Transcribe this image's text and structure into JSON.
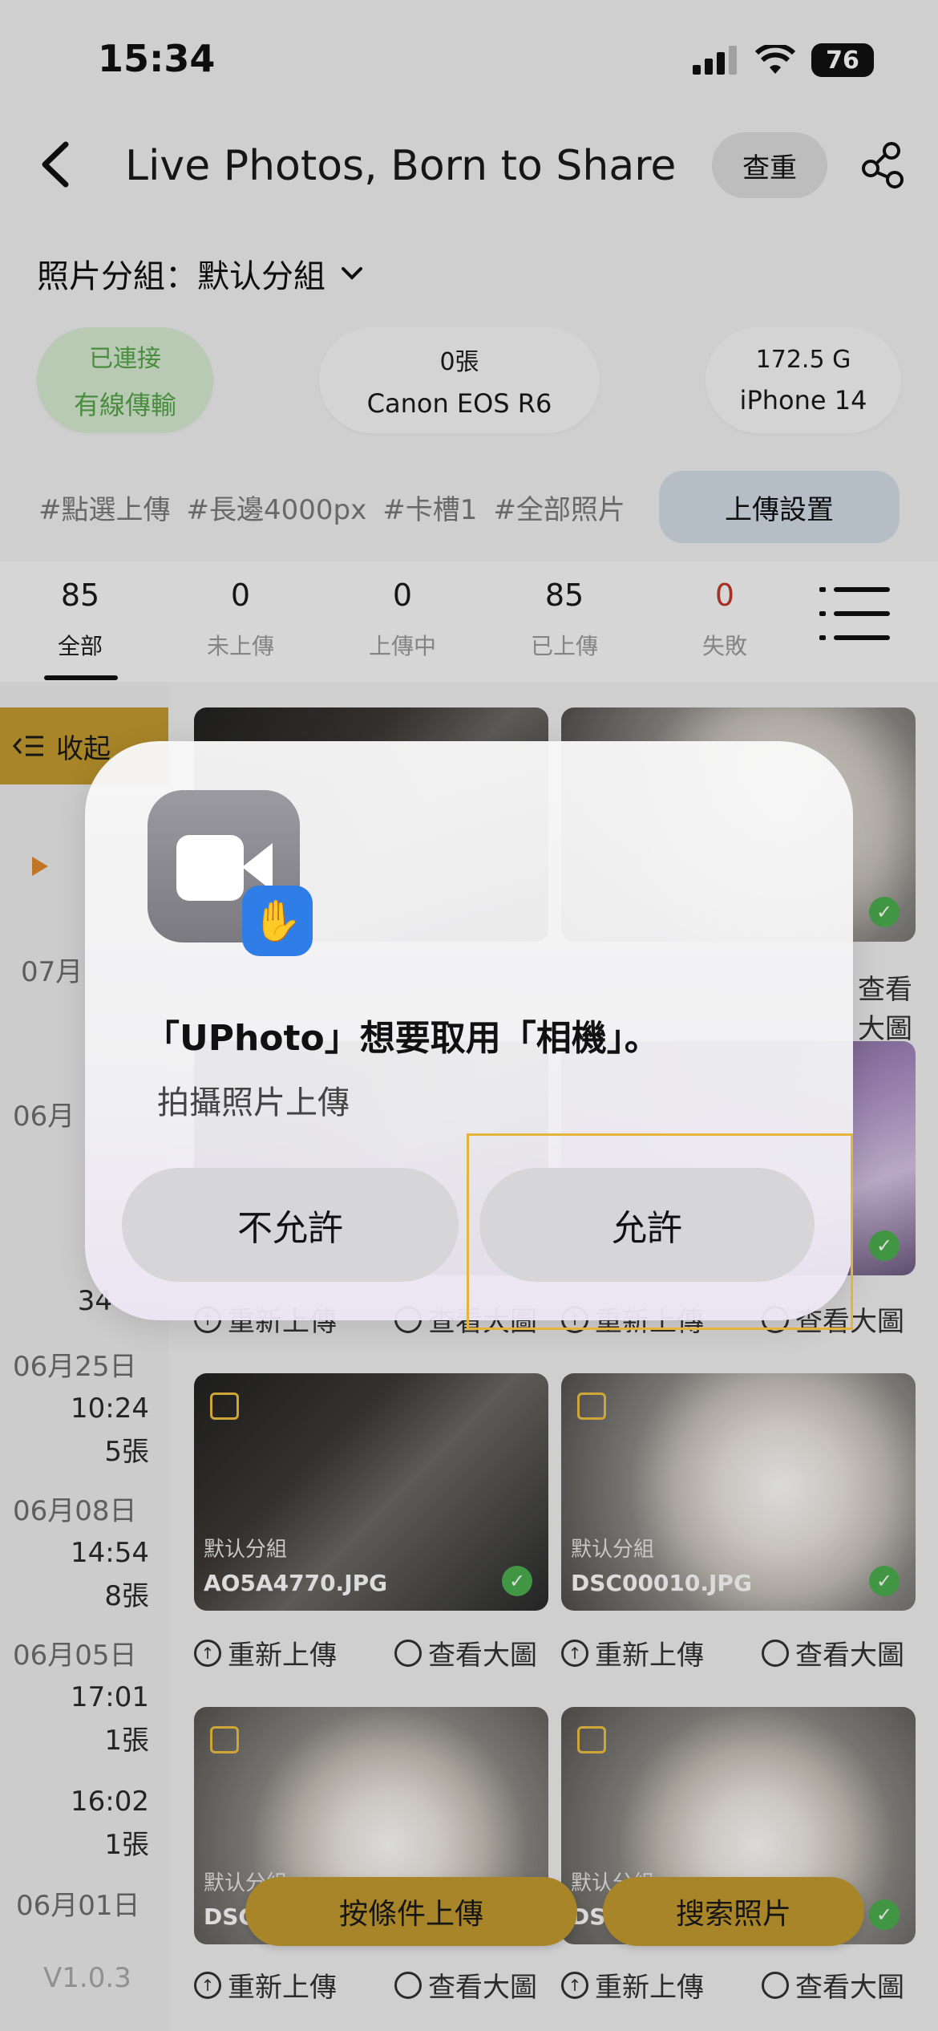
{
  "status_bar": {
    "time": "15:34",
    "battery": "76"
  },
  "nav": {
    "title": "Live Photos, Born to Share",
    "dedupe_label": "查重"
  },
  "group": {
    "label": "照片分組：默认分組"
  },
  "pills": {
    "connection_line1": "已連接",
    "connection_line2": "有線傳輸",
    "camera_count": "0張",
    "camera_name": "Canon EOS R6",
    "phone_storage": "172.5 G",
    "phone_name": "iPhone 14"
  },
  "tags": [
    "#點選上傳",
    "#長邊4000px",
    "#卡槽1",
    "#全部照片"
  ],
  "upload_settings_label": "上傳設置",
  "stats": [
    {
      "num": "85",
      "label": "全部"
    },
    {
      "num": "0",
      "label": "未上傳"
    },
    {
      "num": "0",
      "label": "上傳中"
    },
    {
      "num": "85",
      "label": "已上傳"
    },
    {
      "num": "0",
      "label": "失敗"
    }
  ],
  "sidebar": {
    "collapse_label": "收起",
    "partial_07": "07月",
    "partial_06a": "06月",
    "partial_34": "34",
    "group1": {
      "date": "06月25日",
      "time": "10:24",
      "count": "5張"
    },
    "group2": {
      "date": "06月08日",
      "time": "14:54",
      "count": "8張"
    },
    "group3": {
      "date": "06月05日",
      "time1": "17:01",
      "count1": "1張",
      "time2": "16:02",
      "count2": "1張"
    },
    "group4": {
      "date": "06月01日"
    },
    "version": "V1.0.3"
  },
  "cards": {
    "row3_left": {
      "group": "默认分組",
      "filename": "AO5A4770.JPG"
    },
    "row3_right": {
      "group": "默认分組",
      "filename": "DSC00010.JPG"
    },
    "row4_left": {
      "group": "默认分組",
      "filename": "DSC"
    },
    "row4_right": {
      "group": "默认分組",
      "filename": "DS"
    }
  },
  "actions": {
    "reupload": "重新上傳",
    "view_large": "查看大圖"
  },
  "alert": {
    "title": "「UPhoto」想要取用「相機」。",
    "message": "拍攝照片上傳",
    "deny_label": "不允許",
    "allow_label": "允許"
  },
  "bottom": {
    "conditional_upload": "按條件上傳",
    "search_photos": "搜索照片"
  },
  "colors": {
    "accent": "#c49b2f",
    "success": "#4caf50",
    "fail": "#c0392b"
  }
}
